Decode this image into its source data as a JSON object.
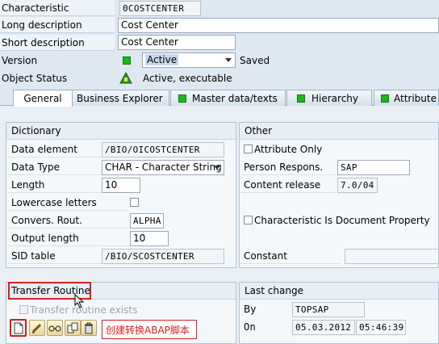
{
  "header": {
    "characteristic_label": "Characteristic",
    "characteristic_value": "0COSTCENTER",
    "long_desc_label": "Long description",
    "long_desc_value": "Cost Center",
    "short_desc_label": "Short description",
    "short_desc_value": "Cost Center",
    "version_label": "Version",
    "version_value": "Active",
    "version_status": "Saved",
    "object_status_label": "Object Status",
    "object_status_value": "Active, executable"
  },
  "tabs": [
    {
      "label": "General"
    },
    {
      "label": "Business Explorer"
    },
    {
      "label": "Master data/texts"
    },
    {
      "label": "Hierarchy"
    },
    {
      "label": "Attribute"
    }
  ],
  "dictionary": {
    "title": "Dictionary",
    "data_element_label": "Data element",
    "data_element_value": "/BIO/OICOSTCENTER",
    "data_type_label": "Data Type",
    "data_type_value": "CHAR - Character String",
    "length_label": "Length",
    "length_value": "10",
    "lowercase_label": "Lowercase letters",
    "convers_label": "Convers. Rout.",
    "convers_value": "ALPHA",
    "output_length_label": "Output length",
    "output_length_value": "10",
    "sid_table_label": "SID table",
    "sid_table_value": "/BIO/SCOSTCENTER"
  },
  "other": {
    "title": "Other",
    "attribute_only_label": "Attribute Only",
    "person_label": "Person Respons.",
    "person_value": "SAP",
    "content_release_label": "Content release",
    "content_release_value": "7.0/04",
    "doc_property_label": "Characteristic Is Document Property",
    "constant_label": "Constant",
    "constant_value": ""
  },
  "transfer": {
    "title": "Transfer Routine",
    "exists_label": "Transfer routine exists",
    "annotation": "创建转换ABAP脚本"
  },
  "last_change": {
    "title": "Last change",
    "by_label": "By",
    "by_value": "TOPSAP",
    "on_label": "On",
    "date_value": "05.03.2012",
    "time_value": "05:46:39"
  },
  "colors": {
    "background": "#dfe8f1",
    "annotation_red": "#d52121",
    "status_green": "#1fb61f"
  }
}
